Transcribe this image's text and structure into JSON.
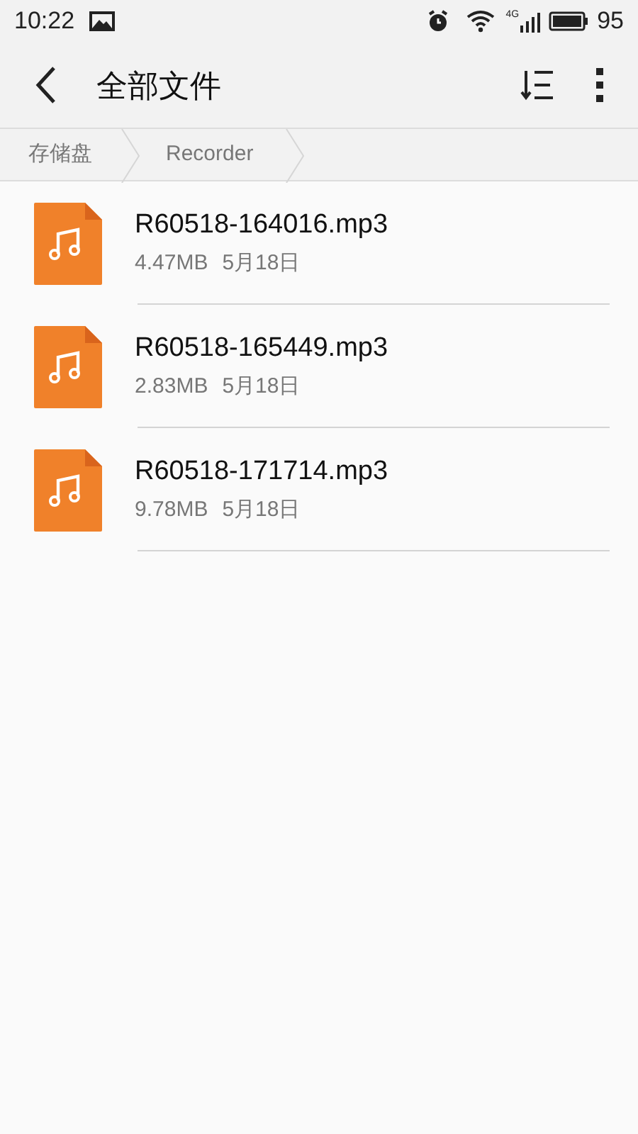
{
  "status_bar": {
    "time": "10:22",
    "network": "4G",
    "battery": "95"
  },
  "app_bar": {
    "title": "全部文件"
  },
  "breadcrumb": [
    {
      "label": "存储盘"
    },
    {
      "label": "Recorder"
    }
  ],
  "files": [
    {
      "name": "R60518-164016.mp3",
      "size": "4.47MB",
      "date": "5月18日"
    },
    {
      "name": "R60518-165449.mp3",
      "size": "2.83MB",
      "date": "5月18日"
    },
    {
      "name": "R60518-171714.mp3",
      "size": "9.78MB",
      "date": "5月18日"
    }
  ]
}
